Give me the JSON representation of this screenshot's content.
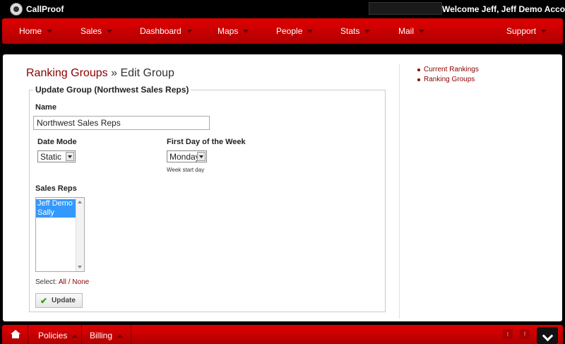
{
  "header": {
    "brand": "CallProof",
    "welcome": "Welcome Jeff, Jeff Demo Account"
  },
  "nav": {
    "items": [
      "Home",
      "Sales",
      "Dashboard",
      "Maps",
      "People",
      "Stats",
      "Mail",
      "Support"
    ]
  },
  "breadcrumb": {
    "parent": "Ranking Groups",
    "separator": "»",
    "current": "Edit Group"
  },
  "form": {
    "legend": "Update Group (Northwest Sales Reps)",
    "name_label": "Name",
    "name_value": "Northwest Sales Reps",
    "date_mode_label": "Date Mode",
    "date_mode_value": "Static",
    "first_day_label": "First Day of the Week",
    "first_day_value": "Monday",
    "first_day_hint": "Week start day",
    "sales_reps_label": "Sales Reps",
    "sales_reps": [
      "Jeff Demo",
      "Sally Smith"
    ],
    "select_prefix": "Select:",
    "select_all": "All",
    "select_sep": "/",
    "select_none": "None",
    "update_label": "Update"
  },
  "sidebar": {
    "links": [
      "Current Rankings",
      "Ranking Groups"
    ]
  },
  "footer": {
    "policies": "Policies",
    "billing": "Billing",
    "social": [
      "t",
      "f"
    ]
  },
  "colors": {
    "nav_red": "#d00000",
    "link_red": "#8b0000",
    "selection_blue": "#3399ff"
  }
}
